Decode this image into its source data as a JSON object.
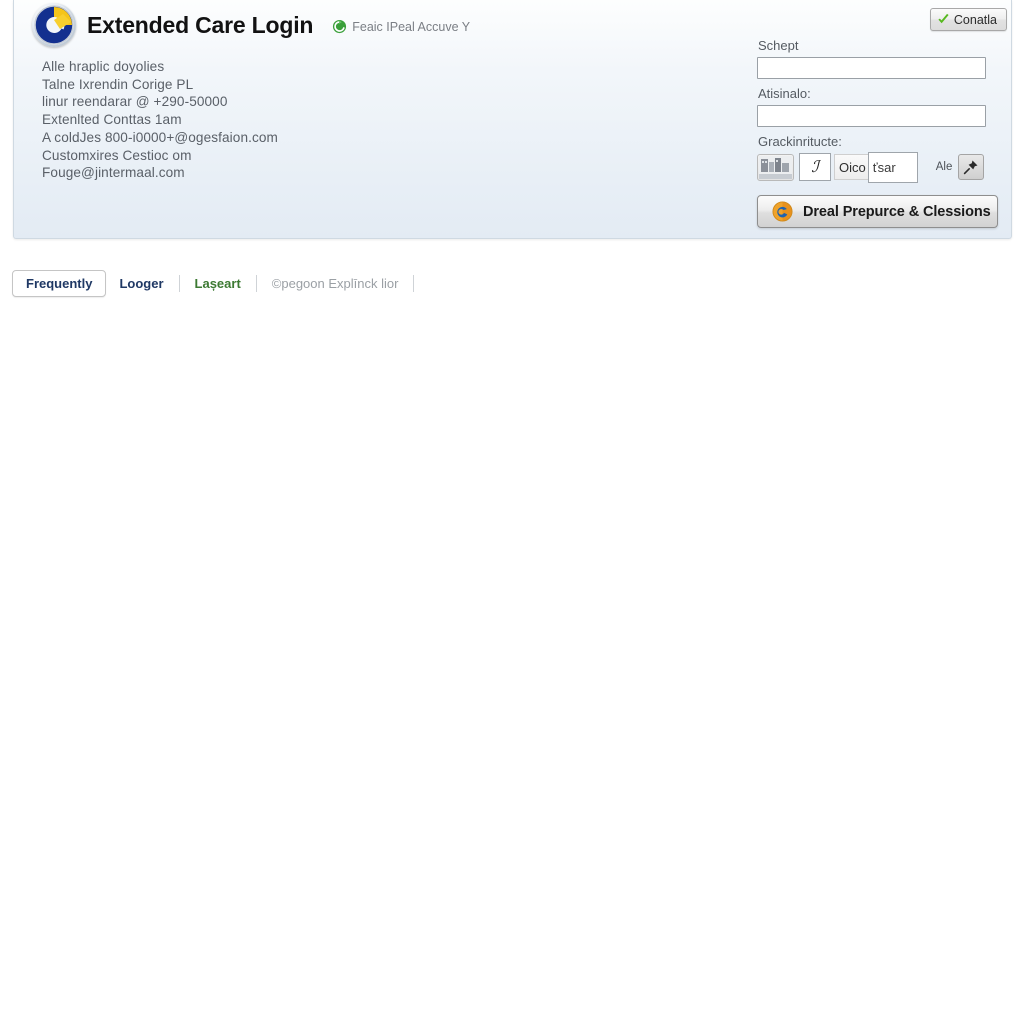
{
  "panel": {
    "header": {
      "logo_icon": "circular-c-emblem-logo",
      "title": "Extended Care Login",
      "status": {
        "icon": "green-refresh-icon",
        "text": "Feaic IPeal Accuve Y"
      }
    },
    "info_lines": [
      "Alle hraplic doyolies",
      "Talne Ixrendin Corige PL",
      "linur reendarar @ +290-50000",
      "Extenlted Conttas 1am",
      "A coldJes 800-i0000+@ogesfaion.com",
      "Customxires Cestioc om",
      "Fouge@jintermaal.com"
    ],
    "form": {
      "confirm_button": {
        "icon": "green-check-icon",
        "label": "Conatla"
      },
      "field_one": {
        "label": "Schept",
        "value": "",
        "placeholder": ""
      },
      "field_two": {
        "label": "Atisinalo:",
        "value": "",
        "placeholder": ""
      },
      "captcha": {
        "label": "Grackinritucte:",
        "image_button_icon": "captcha-image-icon",
        "glyph": "ℐ",
        "word_chip": "Oico",
        "input_value": "ťsar",
        "aux_label": "Ale",
        "pin_button_icon": "pin-icon"
      },
      "primary_button": {
        "icon": "browser-globe-icon",
        "label": "Dreal Prepurce & Clessions"
      }
    }
  },
  "tabs": [
    {
      "label": "Frequently",
      "state": "active"
    },
    {
      "label": "Looger",
      "state": "normal"
    },
    {
      "label": "Lașeart",
      "state": "alt"
    },
    {
      "label": "©pegoon Explīnck lior",
      "state": "muted"
    }
  ],
  "colors": {
    "panel_bg": "#e8eff6",
    "panel_border": "#cfd9e2",
    "title": "#121212",
    "info_text": "#5a6068",
    "tab_active_text": "#1f3864",
    "tab_alt_text": "#3d7a33",
    "tab_muted_text": "#9ba0a5",
    "accent_green": "#4caf1e",
    "logo_blue": "#13308f",
    "logo_yellow": "#f4c41a"
  }
}
